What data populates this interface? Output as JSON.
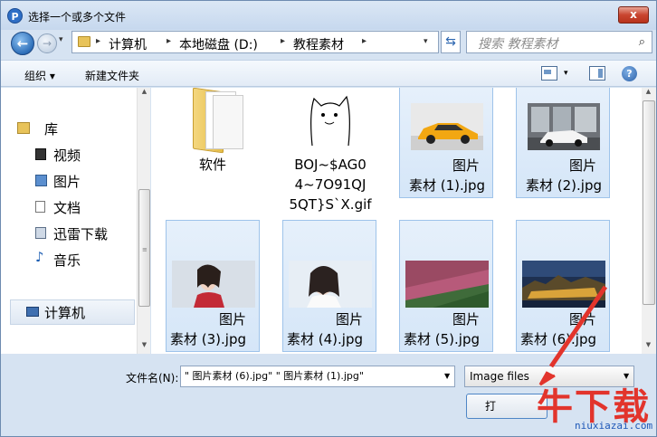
{
  "window": {
    "title": "选择一个或多个文件",
    "close_label": "x"
  },
  "nav": {
    "back_glyph": "←",
    "fwd_glyph": "→",
    "drop_glyph": "▾"
  },
  "address": {
    "crumbs": [
      "计算机",
      "本地磁盘 (D:)",
      "教程素材"
    ],
    "sep_glyph": "▸",
    "drop_glyph": "▾",
    "refresh_glyph": "⇆"
  },
  "search": {
    "placeholder": "搜索 教程素材",
    "icon_glyph": "⌕"
  },
  "toolbar": {
    "organize": "组织 ▾",
    "new_folder": "新建文件夹",
    "views_drop": "▾",
    "help": "?"
  },
  "sidebar": {
    "items": [
      {
        "label": "库",
        "icon": "library-icon"
      },
      {
        "label": "视频",
        "icon": "video-icon"
      },
      {
        "label": "图片",
        "icon": "pictures-icon"
      },
      {
        "label": "文档",
        "icon": "documents-icon"
      },
      {
        "label": "迅雷下载",
        "icon": "download-icon"
      },
      {
        "label": "音乐",
        "icon": "music-icon"
      },
      {
        "label": "计算机",
        "icon": "computer-icon"
      }
    ],
    "music_glyph": "♪"
  },
  "files": [
    {
      "line1": "",
      "line2": "软件",
      "type": "folder",
      "selected": false
    },
    {
      "line1": "BOJ~$AG0",
      "line2": "4~7O91QJ",
      "line3": "5QT}S`X.gif",
      "type": "gif",
      "selected": false
    },
    {
      "line1": "图片",
      "line2": "素材 (1).jpg",
      "type": "car-yellow",
      "selected": true
    },
    {
      "line1": "图片",
      "line2": "素材 (2).jpg",
      "type": "car-white",
      "selected": true
    },
    {
      "line1": "图片",
      "line2": "素材 (3).jpg",
      "type": "woman-red",
      "selected": true
    },
    {
      "line1": "图片",
      "line2": "素材 (4).jpg",
      "type": "woman-white",
      "selected": true
    },
    {
      "line1": "图片",
      "line2": "素材 (5).jpg",
      "type": "flowers",
      "selected": true
    },
    {
      "line1": "图片",
      "line2": "素材 (6).jpg",
      "type": "city-night",
      "selected": true
    }
  ],
  "bottom": {
    "filename_label": "文件名(N):",
    "filename_value": "\"         图片素材 (6).jpg\" \"         图片素材 (1).jpg\"",
    "filetype_value": "Image files",
    "open_label": "打",
    "drop_glyph": "▼"
  },
  "watermark": {
    "logo": "牛下载",
    "url": "niuxiazai.com"
  },
  "colors": {
    "accent": "#3c7fc4",
    "selection": "#d5e6f8",
    "watermark": "#e2342c"
  }
}
